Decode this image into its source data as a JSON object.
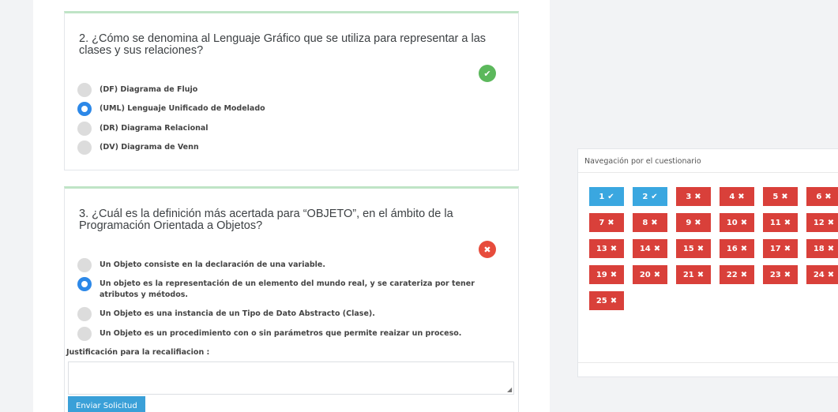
{
  "question2": {
    "title": "2. ¿Cómo se denomina al Lenguaje Gráfico que se utiliza para representar a las clases y sus relaciones?",
    "status_icon": "check-icon",
    "status_glyph": "✔",
    "options": [
      {
        "label": "(DF) Diagrama de Flujo",
        "selected": false
      },
      {
        "label": "(UML) Lenguaje Unificado de Modelado",
        "selected": true
      },
      {
        "label": "(DR) Diagrama Relacional",
        "selected": false
      },
      {
        "label": "(DV) Diagrama de Venn",
        "selected": false
      }
    ]
  },
  "question3": {
    "title": "3. ¿Cuál es la definición más acertada para “OBJETO”, en el ámbito de la Programación Orientada a Objetos?",
    "status_icon": "x-icon",
    "status_glyph": "✖",
    "options": [
      {
        "label": "Un Objeto consiste en la declaración de una variable.",
        "selected": false
      },
      {
        "label": "Un objeto es la representación de un elemento del mundo real, y se carateriza por tener atributos y métodos.",
        "selected": true
      },
      {
        "label": "Un Objeto es una instancia de un Tipo de Dato Abstracto (Clase).",
        "selected": false
      },
      {
        "label": "Un Objeto es un procedimiento con o sin parámetros que permite reaizar un proceso.",
        "selected": false
      }
    ],
    "justification_label": "Justificación para la recalifiacion :",
    "justification_value": "",
    "send_button": "Enviar Solicitud"
  },
  "navigation": {
    "title": "Navegación por el cuestionario",
    "colors": {
      "correct": "#3aa7e0",
      "wrong": "#d9403a"
    },
    "items": [
      {
        "number": "1",
        "state": "correct",
        "mark": "✔"
      },
      {
        "number": "2",
        "state": "correct",
        "mark": "✔"
      },
      {
        "number": "3",
        "state": "wrong",
        "mark": "✖"
      },
      {
        "number": "4",
        "state": "wrong",
        "mark": "✖"
      },
      {
        "number": "5",
        "state": "wrong",
        "mark": "✖"
      },
      {
        "number": "6",
        "state": "wrong",
        "mark": "✖"
      },
      {
        "number": "7",
        "state": "wrong",
        "mark": "✖"
      },
      {
        "number": "8",
        "state": "wrong",
        "mark": "✖"
      },
      {
        "number": "9",
        "state": "wrong",
        "mark": "✖"
      },
      {
        "number": "10",
        "state": "wrong",
        "mark": "✖"
      },
      {
        "number": "11",
        "state": "wrong",
        "mark": "✖"
      },
      {
        "number": "12",
        "state": "wrong",
        "mark": "✖"
      },
      {
        "number": "13",
        "state": "wrong",
        "mark": "✖"
      },
      {
        "number": "14",
        "state": "wrong",
        "mark": "✖"
      },
      {
        "number": "15",
        "state": "wrong",
        "mark": "✖"
      },
      {
        "number": "16",
        "state": "wrong",
        "mark": "✖"
      },
      {
        "number": "17",
        "state": "wrong",
        "mark": "✖"
      },
      {
        "number": "18",
        "state": "wrong",
        "mark": "✖"
      },
      {
        "number": "19",
        "state": "wrong",
        "mark": "✖"
      },
      {
        "number": "20",
        "state": "wrong",
        "mark": "✖"
      },
      {
        "number": "21",
        "state": "wrong",
        "mark": "✖"
      },
      {
        "number": "22",
        "state": "wrong",
        "mark": "✖"
      },
      {
        "number": "23",
        "state": "wrong",
        "mark": "✖"
      },
      {
        "number": "24",
        "state": "wrong",
        "mark": "✖"
      },
      {
        "number": "25",
        "state": "wrong",
        "mark": "✖"
      }
    ]
  }
}
